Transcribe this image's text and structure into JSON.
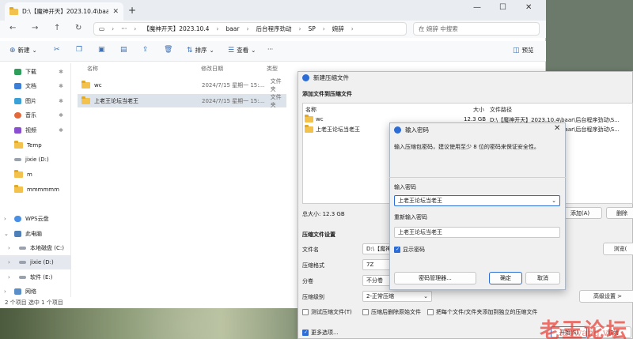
{
  "explorer": {
    "tab_title": "D:\\【魔神开天】2023.10.4\\baa",
    "breadcrumbs": [
      "【魔神开天】2023.10.4",
      "baar",
      "后台程序劲动",
      "SP",
      "婉辞"
    ],
    "search_placeholder": "在 婉辞 中搜索",
    "toolbar": {
      "new": "新建",
      "sort": "排序",
      "view": "查看",
      "more": "···",
      "preview": "预览"
    },
    "sidebar": [
      {
        "label": "下载",
        "icon": "download-icon",
        "pinned": true
      },
      {
        "label": "文档",
        "icon": "document-icon",
        "pinned": true
      },
      {
        "label": "图片",
        "icon": "picture-icon",
        "pinned": true
      },
      {
        "label": "音乐",
        "icon": "music-icon",
        "pinned": true
      },
      {
        "label": "视频",
        "icon": "video-icon",
        "pinned": true
      },
      {
        "label": "Temp",
        "icon": "folder-icon"
      },
      {
        "label": "jixie (D:)",
        "icon": "drive-icon"
      },
      {
        "label": "m",
        "icon": "folder-icon"
      },
      {
        "label": "mmmmmm",
        "icon": "folder-icon"
      },
      {
        "label": "WPS云盘",
        "icon": "cloud-icon"
      },
      {
        "label": "此电脑",
        "icon": "pc-icon"
      },
      {
        "label": "本地磁盘 (C:)",
        "icon": "drive-icon"
      },
      {
        "label": "jixie (D:)",
        "icon": "drive-icon"
      },
      {
        "label": "软件 (E:)",
        "icon": "drive-icon"
      },
      {
        "label": "网络",
        "icon": "network-icon"
      }
    ],
    "columns": [
      "名称",
      "修改日期",
      "类型"
    ],
    "files": [
      {
        "name": "wc",
        "date": "2024/7/15 星期一 15:...",
        "type": "文件夹"
      },
      {
        "name": "上老王论坛当老王",
        "date": "2024/7/15 星期一 15:...",
        "type": "文件夹"
      }
    ],
    "status": "2 个项目    选中 1 个项目"
  },
  "archive": {
    "title": "新建压缩文件",
    "section_add": "添加文件到压缩文件",
    "columns": [
      "名称",
      "大小",
      "文件路径"
    ],
    "rows": [
      {
        "name": "wc",
        "size": "12.3 GB",
        "path": "D:\\【魔神开天】2023.10.4\\baar\\后台程序劲动\\S..."
      },
      {
        "name": "上老王论坛当老王",
        "size": "",
        "path": "D:\\【魔神开天】2023.10.4\\baar\\后台程序劲动\\S..."
      }
    ],
    "total_size": "总大小: 12.3 GB",
    "add_button": "添加(A)",
    "delete_button": "删除",
    "settings_title": "压缩文件设置",
    "filename_label": "文件名",
    "filename_value": "D:\\【魔神",
    "browse_button": "浏览(",
    "format_label": "压缩格式",
    "format_value": "7Z",
    "split_label": "分卷",
    "split_value": "不分卷",
    "level_label": "压缩级别",
    "level_value": "2-正常压缩",
    "advanced_button": "高级设置 >",
    "options": [
      "测试压缩文件(T)",
      "压缩后删除原始文件",
      "把每个文件/文件夹添加到独立的压缩文件"
    ],
    "more_options": "更多选项...",
    "start_button": "开始(S)",
    "cancel_button": "取消"
  },
  "password": {
    "title": "输入密码",
    "hint": "输入压缩包密码，建议使用至少 8 位的密码来保证安全性。",
    "label1": "输入密码",
    "value1": "上老王论坛当老王",
    "label2": "重新输入密码",
    "value2": "上老王论坛当老王",
    "show_label": "显示密码",
    "manager_button": "密码管理器...",
    "ok_button": "确定",
    "cancel_button": "取消"
  },
  "watermark": {
    "text": "老王论坛",
    "sub": "laowang.vip"
  }
}
